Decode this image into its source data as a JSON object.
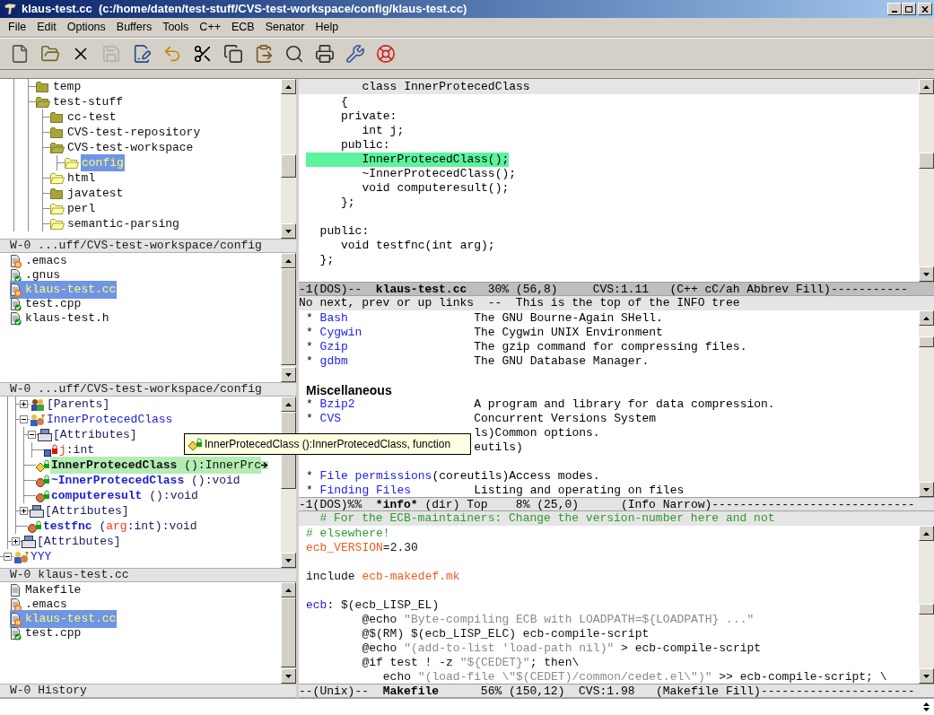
{
  "window": {
    "title": "klaus-test.cc  (c:/home/daten/test-stuff/CVS-test-workspace/config/klaus-test.cc)"
  },
  "menu": [
    "File",
    "Edit",
    "Options",
    "Buffers",
    "Tools",
    "C++",
    "ECB",
    "Senator",
    "Help"
  ],
  "toolbar": [
    {
      "kind": "new",
      "disabled": false
    },
    {
      "kind": "open",
      "disabled": false
    },
    {
      "kind": "close",
      "disabled": false
    },
    {
      "kind": "save",
      "disabled": true
    },
    {
      "kind": "save-as",
      "disabled": false
    },
    {
      "kind": "undo",
      "disabled": false
    },
    {
      "kind": "cut",
      "disabled": false
    },
    {
      "kind": "copy",
      "disabled": false
    },
    {
      "kind": "paste",
      "disabled": false
    },
    {
      "kind": "search",
      "disabled": false
    },
    {
      "kind": "print",
      "disabled": false
    },
    {
      "kind": "tools",
      "disabled": false
    },
    {
      "kind": "help",
      "disabled": false
    }
  ],
  "directories": {
    "items": [
      {
        "children": [
          {
            "children": [
              {
                "name": "temp",
                "kind": "closed",
                "selected": false
              },
              {
                "name": "test-stuff",
                "kind": "open",
                "selected": false,
                "children": [
                  {
                    "name": "cc-test",
                    "kind": "closed",
                    "selected": false
                  },
                  {
                    "name": "CVS-test-repository",
                    "kind": "closed",
                    "selected": false
                  },
                  {
                    "name": "CVS-test-workspace",
                    "kind": "open",
                    "selected": false,
                    "children": [
                      {
                        "name": "config",
                        "kind": "empty",
                        "selected": true
                      }
                    ]
                  },
                  {
                    "name": "html",
                    "kind": "empty",
                    "selected": false
                  },
                  {
                    "name": "javatest",
                    "kind": "closed",
                    "selected": false
                  },
                  {
                    "name": "perl",
                    "kind": "empty",
                    "selected": false
                  },
                  {
                    "name": "semantic-parsing",
                    "kind": "empty",
                    "selected": false
                  }
                ]
              }
            ]
          }
        ]
      }
    ],
    "mode_line": "W-0 ...uff/CVS-test-workspace/config"
  },
  "sources": {
    "items": [
      {
        "name": ".emacs",
        "kind": "modified",
        "selected": false
      },
      {
        "name": ".gnus",
        "kind": "ok",
        "selected": false
      },
      {
        "name": "klaus-test.cc",
        "kind": "modified",
        "selected": true
      },
      {
        "name": "test.cpp",
        "kind": "ok",
        "selected": false
      },
      {
        "name": "klaus-test.h",
        "kind": "ok",
        "selected": false
      }
    ],
    "mode_line": "W-0 ...uff/CVS-test-workspace/config"
  },
  "methods": {
    "items": [
      {
        "children": [
          {
            "children": [
              {
                "kind": "parents",
                "expanded": false,
                "selected": false,
                "label": [
                  {
                    "kind": "plain",
                    "text": "[Parents]"
                  }
                ]
              },
              {
                "kind": "class",
                "expanded": true,
                "selected": false,
                "label": [
                  {
                    "kind": "name",
                    "text": "InnerProtecedClass"
                  }
                ],
                "children": [
                  {
                    "kind": "attributes",
                    "expanded": true,
                    "selected": false,
                    "label": [
                      {
                        "kind": "plain",
                        "text": "[Attributes]"
                      }
                    ],
                    "children": [
                      {
                        "kind": "variable",
                        "selected": false,
                        "label": [
                          {
                            "kind": "param",
                            "text": "j"
                          },
                          {
                            "kind": "plain",
                            "text": ":int"
                          }
                        ]
                      }
                    ]
                  },
                  {
                    "kind": "constructor",
                    "selected": true,
                    "truncated": true,
                    "label": [
                      {
                        "kind": "name",
                        "text": "InnerProtecedClass"
                      },
                      {
                        "kind": "plain",
                        "text": " ():InnerPrc"
                      }
                    ]
                  },
                  {
                    "kind": "method",
                    "selected": false,
                    "label": [
                      {
                        "kind": "name",
                        "text": "~InnerProtecedClass"
                      },
                      {
                        "kind": "plain",
                        "text": " ():void"
                      }
                    ]
                  },
                  {
                    "kind": "method",
                    "selected": false,
                    "label": [
                      {
                        "kind": "name",
                        "text": "computeresult"
                      },
                      {
                        "kind": "plain",
                        "text": " ():void"
                      }
                    ]
                  }
                ]
              },
              {
                "kind": "attributes",
                "expanded": false,
                "selected": false,
                "label": [
                  {
                    "kind": "plain",
                    "text": "[Attributes]"
                  }
                ]
              },
              {
                "kind": "method",
                "selected": false,
                "label": [
                  {
                    "kind": "name",
                    "text": "testfnc"
                  },
                  {
                    "kind": "plain",
                    "text": " ("
                  },
                  {
                    "kind": "param",
                    "text": "arg"
                  },
                  {
                    "kind": "plain",
                    "text": ":int):void"
                  }
                ]
              }
            ]
          },
          {
            "kind": "attributes",
            "expanded": false,
            "selected": false,
            "label": [
              {
                "kind": "plain",
                "text": "[Attributes]"
              }
            ]
          }
        ]
      },
      {
        "kind": "class",
        "expanded": true,
        "selected": false,
        "label": [
          {
            "kind": "name",
            "text": "YYY"
          }
        ]
      }
    ],
    "mode_line": "W-0 klaus-test.cc"
  },
  "history": {
    "items": [
      {
        "name": "Makefile",
        "kind": "plain",
        "selected": false
      },
      {
        "name": ".emacs",
        "kind": "modified",
        "selected": false
      },
      {
        "name": "klaus-test.cc",
        "kind": "modified",
        "selected": true
      },
      {
        "name": "test.cpp",
        "kind": "ok",
        "selected": false
      }
    ],
    "mode_line": "W-0 History"
  },
  "tooltip": {
    "text": "InnerProtecedClass ():InnerProtecedClass, function"
  },
  "code": {
    "header": "        class InnerProtecedClass",
    "lines": [
      {
        "kind": "code",
        "text": "     {",
        "highlighted": false
      },
      {
        "kind": "code",
        "text": "     private:",
        "highlighted": false
      },
      {
        "kind": "code",
        "text": "        int j;",
        "highlighted": false
      },
      {
        "kind": "code",
        "text": "     public:",
        "highlighted": false
      },
      {
        "kind": "code",
        "text": "        InnerProtecedClass();",
        "highlighted": true
      },
      {
        "kind": "code",
        "text": "        ~InnerProtecedClass();",
        "highlighted": false
      },
      {
        "kind": "code",
        "text": "        void computeresult();",
        "highlighted": false
      },
      {
        "kind": "code",
        "text": "     };",
        "highlighted": false
      },
      {
        "kind": "blank",
        "highlighted": false
      },
      {
        "kind": "code",
        "text": "  public:",
        "highlighted": false
      },
      {
        "kind": "code",
        "text": "     void testfnc(int arg);",
        "highlighted": false
      },
      {
        "kind": "code",
        "text": "  };",
        "highlighted": false
      }
    ],
    "mode_line": [
      {
        "kind": "plain",
        "text": "-1(DOS)--  "
      },
      {
        "kind": "buffer",
        "text": "klaus-test.cc"
      },
      {
        "kind": "plain",
        "text": "   30% (56,8)     CVS:1.11   (C++ cC/ah Abbrev Fill)-----------"
      }
    ]
  },
  "info": {
    "header": "No next, prev or up links  --  This is the top of the INFO tree",
    "items": [
      {
        "kind": "entry",
        "bullet": "*",
        "name": "Bash",
        "desc": "The GNU Bourne-Again SHell."
      },
      {
        "kind": "entry",
        "bullet": "*",
        "name": "Cygwin",
        "desc": "The Cygwin UNIX Environment"
      },
      {
        "kind": "entry",
        "bullet": "*",
        "name": "Gzip",
        "desc": "The gzip command for compressing files."
      },
      {
        "kind": "entry",
        "bullet": "*",
        "name": "gdbm",
        "desc": "The GNU Database Manager."
      },
      {
        "kind": "gap"
      },
      {
        "kind": "heading",
        "text": "Miscellaneous"
      },
      {
        "kind": "entry",
        "bullet": "*",
        "name": "Bzip2",
        "desc": "A program and library for data compression."
      },
      {
        "kind": "entry",
        "bullet": "*",
        "name": "CVS",
        "desc": "Concurrent Versions System"
      },
      {
        "kind": "partial",
        "text": "ls)Common options."
      },
      {
        "kind": "partial",
        "text": "eutils)"
      },
      {
        "kind": "gap"
      },
      {
        "kind": "inline",
        "bullet": "*",
        "name": "File permissions",
        "desc": "(coreutils)Access modes."
      },
      {
        "kind": "entry",
        "bullet": "*",
        "name": "Finding Files",
        "desc": "Listing and operating on files"
      }
    ],
    "mode_line": [
      {
        "kind": "plain",
        "text": "-1(DOS)%%  "
      },
      {
        "kind": "buffer",
        "text": "*info*"
      },
      {
        "kind": "plain",
        "text": " (dir) Top    8% (25,0)      (Info Narrow)-----------------------------"
      }
    ]
  },
  "makefile": {
    "header": "   # For the ECB-maintainers: Change the version-number here and not",
    "lines": [
      {
        "kind": "code",
        "segments": [
          {
            "kind": "comment",
            "text": "# elsewhere!"
          }
        ]
      },
      {
        "kind": "code",
        "segments": [
          {
            "kind": "variable",
            "text": "ecb_VERSION"
          },
          {
            "kind": "plain",
            "text": "=2.30"
          }
        ]
      },
      {
        "kind": "blank"
      },
      {
        "kind": "code",
        "segments": [
          {
            "kind": "plain",
            "text": "include "
          },
          {
            "kind": "variable",
            "text": "ecb-makedef.mk"
          }
        ]
      },
      {
        "kind": "blank"
      },
      {
        "kind": "code",
        "segments": [
          {
            "kind": "target",
            "text": "ecb"
          },
          {
            "kind": "plain",
            "text": ": $(ecb_LISP_EL)"
          }
        ]
      },
      {
        "kind": "code",
        "segments": [
          {
            "kind": "plain",
            "text": "        @echo "
          },
          {
            "kind": "string",
            "text": "\"Byte-compiling ECB with LOADPATH=${LOADPATH} ...\""
          }
        ]
      },
      {
        "kind": "code",
        "segments": [
          {
            "kind": "plain",
            "text": "        @$(RM) $(ecb_LISP_ELC) ecb-compile-script"
          }
        ]
      },
      {
        "kind": "code",
        "segments": [
          {
            "kind": "plain",
            "text": "        @echo "
          },
          {
            "kind": "string",
            "text": "\"(add-to-list 'load-path nil)\""
          },
          {
            "kind": "plain",
            "text": " > ecb-compile-script"
          }
        ]
      },
      {
        "kind": "code",
        "segments": [
          {
            "kind": "plain",
            "text": "        @if test ! -z "
          },
          {
            "kind": "string",
            "text": "\"${CEDET}\""
          },
          {
            "kind": "plain",
            "text": "; then\\"
          }
        ]
      },
      {
        "kind": "code",
        "segments": [
          {
            "kind": "plain",
            "text": "           echo "
          },
          {
            "kind": "string",
            "text": "\"(load-file \\\"$(CEDET)/common/cedet.el\\\")\""
          },
          {
            "kind": "plain",
            "text": " >> ecb-compile-script; \\"
          }
        ]
      }
    ],
    "mode_line": [
      {
        "kind": "plain",
        "text": "--(Unix)--  "
      },
      {
        "kind": "buffer",
        "text": "Makefile"
      },
      {
        "kind": "plain",
        "text": "      56% (150,12)  CVS:1.98   (Makefile Fill)----------------------"
      }
    ]
  }
}
